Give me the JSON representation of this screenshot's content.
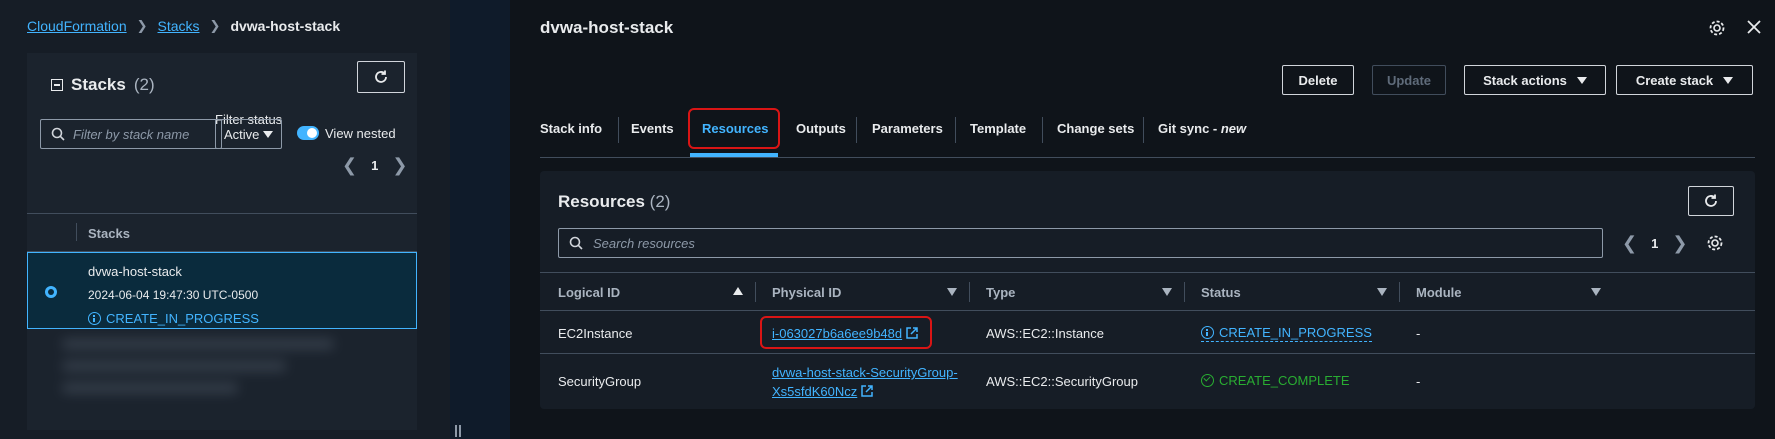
{
  "breadcrumb": {
    "root": "CloudFormation",
    "stacks": "Stacks",
    "current": "dvwa-host-stack"
  },
  "left": {
    "title": "Stacks",
    "count": "(2)",
    "filter_label": "Filter status",
    "search_placeholder": "Filter by stack name",
    "status_filter": "Active",
    "view_nested_label": "View nested",
    "page": "1",
    "column_header": "Stacks",
    "selected_stack": {
      "name": "dvwa-host-stack",
      "date": "2024-06-04 19:47:30 UTC-0500",
      "status": "CREATE_IN_PROGRESS"
    }
  },
  "right": {
    "title": "dvwa-host-stack",
    "buttons": {
      "delete": "Delete",
      "update": "Update",
      "stack_actions": "Stack actions",
      "create_stack": "Create stack"
    },
    "tabs": {
      "stack_info": "Stack info",
      "events": "Events",
      "resources": "Resources",
      "outputs": "Outputs",
      "parameters": "Parameters",
      "template": "Template",
      "change_sets": "Change sets",
      "git_sync": "Git sync - ",
      "git_sync_new": "new"
    },
    "resources": {
      "title": "Resources",
      "count": "(2)",
      "search_placeholder": "Search resources",
      "page": "1",
      "columns": {
        "logical_id": "Logical ID",
        "physical_id": "Physical ID",
        "type": "Type",
        "status": "Status",
        "module": "Module"
      },
      "rows": [
        {
          "logical_id": "EC2Instance",
          "physical_id": "i-063027b6a6ee9b48d",
          "type": "AWS::EC2::Instance",
          "status": "CREATE_IN_PROGRESS",
          "module": "-"
        },
        {
          "logical_id": "SecurityGroup",
          "physical_id_line1": "dvwa-host-stack-SecurityGroup-",
          "physical_id_line2": "Xs5sfdK60Ncz",
          "type": "AWS::EC2::SecurityGroup",
          "status": "CREATE_COMPLETE",
          "module": "-"
        }
      ]
    }
  },
  "colors": {
    "accent": "#42b4ff",
    "success": "#29ad32",
    "highlight": "#d91515"
  }
}
